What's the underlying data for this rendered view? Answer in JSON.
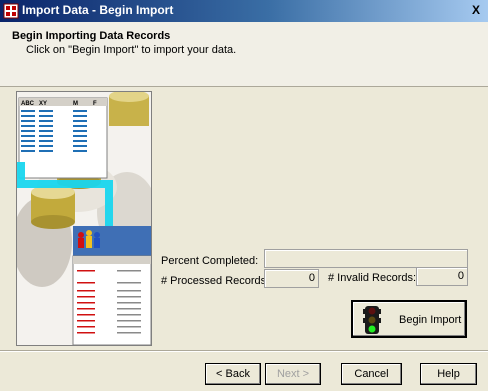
{
  "window": {
    "title": "Import Data - Begin Import",
    "close_label": "X"
  },
  "header": {
    "title": "Begin Importing Data Records",
    "subtitle": "Click on \"Begin Import\" to import your data."
  },
  "illustration": {
    "column_headers": [
      "ABC",
      "XY",
      "M",
      "F"
    ]
  },
  "progress": {
    "percent_label": "Percent Completed:",
    "percent_value": 0,
    "processed_label": "# Processed Records:",
    "processed_value": "0",
    "invalid_label": "# Invalid Records:",
    "invalid_value": "0"
  },
  "begin_import": {
    "label": "Begin Import",
    "icon": "traffic-light-icon"
  },
  "footer": {
    "back_label": "< Back",
    "next_label": "Next >",
    "cancel_label": "Cancel",
    "help_label": "Help"
  }
}
